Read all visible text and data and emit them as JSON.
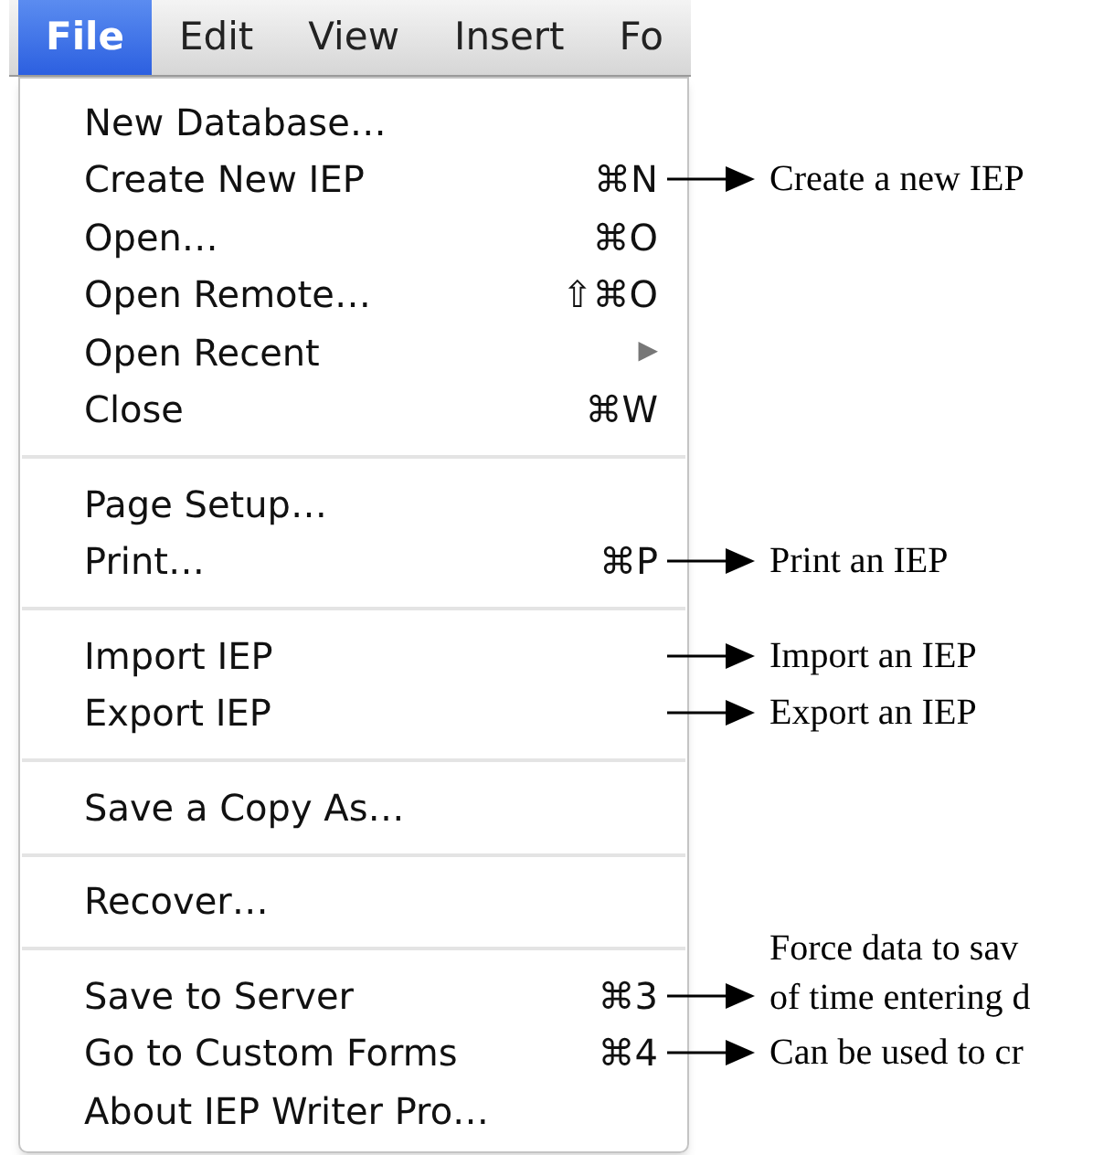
{
  "menu_bar": [
    {
      "label": "File",
      "selected": true
    },
    {
      "label": "Edit",
      "selected": false
    },
    {
      "label": "View",
      "selected": false
    },
    {
      "label": "Insert",
      "selected": false
    },
    {
      "label": "Fo",
      "selected": false
    }
  ],
  "menu": {
    "groups": [
      {
        "items": [
          {
            "label": "New Database…"
          },
          {
            "label": "Create New IEP",
            "shortcut": "⌘N",
            "note": [
              "Create a new IEP"
            ]
          },
          {
            "label": "Open…",
            "shortcut": "⌘O"
          },
          {
            "label": "Open Remote…",
            "shortcut": "⇧⌘O"
          },
          {
            "label": "Open Recent",
            "submenu": "▶"
          },
          {
            "label": "Close",
            "shortcut": "⌘W"
          }
        ]
      },
      {
        "items": [
          {
            "label": "Page Setup…"
          },
          {
            "label": "Print…",
            "shortcut": "⌘P",
            "note": [
              "Print an IEP"
            ]
          }
        ]
      },
      {
        "items": [
          {
            "label": "Import IEP",
            "note": [
              "Import an IEP"
            ]
          },
          {
            "label": "Export IEP",
            "note": [
              "Export an IEP"
            ]
          }
        ]
      },
      {
        "items": [
          {
            "label": "Save a Copy As…"
          }
        ]
      },
      {
        "items": [
          {
            "label": "Recover…"
          }
        ]
      },
      {
        "items": [
          {
            "label": "Save to Server",
            "shortcut": "⌘3",
            "note": [
              "Force data to sav",
              "of time entering d"
            ]
          },
          {
            "label": "Go to Custom Forms",
            "shortcut": "⌘4",
            "note": [
              "Can be used to cr"
            ]
          },
          {
            "label": "About IEP Writer Pro…"
          }
        ]
      }
    ]
  }
}
